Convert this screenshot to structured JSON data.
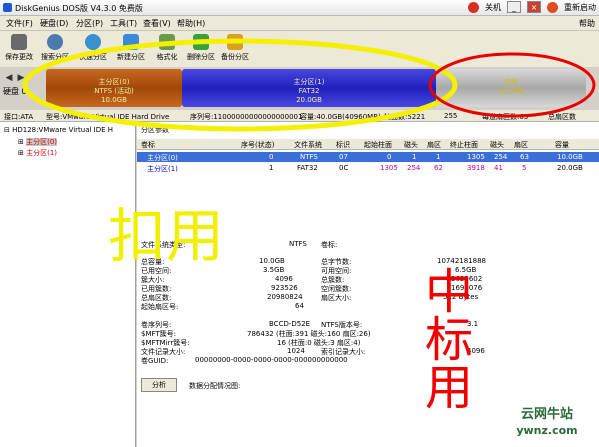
{
  "window": {
    "title": "DiskGenius DOS版 V4.3.0 免费版",
    "power_label": "关机",
    "restart_label": "重新启动"
  },
  "menu": {
    "items": [
      "文件(F)",
      "硬盘(D)",
      "分区(P)",
      "工具(T)",
      "查看(V)",
      "帮助(H)"
    ],
    "help_label": "帮助"
  },
  "toolbar": {
    "buttons": [
      "保存更改",
      "搜索分区",
      "快速分区",
      "新建分区",
      "格式化",
      "删除分区",
      "备份分区"
    ]
  },
  "diskbar": {
    "disk_label": "硬盘 0",
    "partitions": [
      {
        "name": "主分区(0)",
        "fs": "NTFS (活动)",
        "size": "10.0GB"
      },
      {
        "name": "主分区(1)",
        "fs": "FAT32",
        "size": "20.0GB"
      },
      {
        "name": "空闲",
        "fs": "",
        "size": "10.0GB"
      }
    ]
  },
  "infobar": {
    "iface": "接口:ATA",
    "model": "型号:VMware Virtual IDE Hard Drive",
    "serial": "序列号:11000000000000000001",
    "capacity": "容量:40.0GB(40960MB)",
    "cylinders": "柱面数:5221",
    "heads": "255",
    "sectors_per_track": "每道扇区数:63",
    "total_sectors": "总扇区数"
  },
  "tree": {
    "disk": "HD128:VMware Virtual IDE H",
    "parts": [
      "主分区(0)",
      "主分区(1)"
    ]
  },
  "table": {
    "tab": "分区参数",
    "headers": [
      "卷标",
      "序号(状态)",
      "文件系统",
      "标识",
      "起始柱面",
      "磁头",
      "扇区",
      "终止柱面",
      "磁头",
      "扇区",
      "容量"
    ],
    "rows": [
      {
        "label": "主分区(0)",
        "num": "0",
        "fs": "NTFS",
        "id": "07",
        "sc": "0",
        "sh": "1",
        "ss": "1",
        "ec": "1305",
        "eh": "254",
        "es": "63",
        "size": "10.0GB"
      },
      {
        "label": "主分区(1)",
        "num": "1",
        "fs": "FAT32",
        "id": "0C",
        "sc": "1305",
        "sh": "254",
        "ss": "62",
        "ec": "3918",
        "eh": "41",
        "es": "5",
        "size": "20.0GB"
      }
    ]
  },
  "detail": {
    "fs_type_label": "文件系统类型:",
    "fs_type": "NTFS",
    "vol_label": "卷标:",
    "left": [
      [
        "总容量:",
        "10.0GB"
      ],
      [
        "已用空间:",
        "3.5GB"
      ],
      [
        "簇大小:",
        "4096"
      ],
      [
        "已用簇数:",
        "923526"
      ],
      [
        "总扇区数:",
        "20980824"
      ],
      [
        "起始扇区号:",
        "64"
      ]
    ],
    "right": [
      [
        "总字节数:",
        "10742181888"
      ],
      [
        "可用空间:",
        "6.5GB"
      ],
      [
        "总簇数:",
        "2622602"
      ],
      [
        "空闲簇数:",
        "1699076"
      ],
      [
        "扇区大小:",
        "512 Bytes"
      ]
    ],
    "serial": [
      "卷序列号:",
      "BCCD-D52E",
      "NTFS版本号:",
      "3.1"
    ],
    "mft": [
      "$MFT簇号:",
      "786432 (柱面:391 磁头:160 扇区:26)"
    ],
    "mftmirr": [
      "$MFTMirr簇号:",
      "16 (柱面:0 磁头:3 扇区:4)"
    ],
    "rec": [
      "文件记录大小:",
      "1024",
      "索引记录大小:",
      "4096"
    ],
    "guid": [
      "卷GUID:",
      "00000000-0000-0000-0000-000000000000"
    ]
  },
  "bottom": {
    "analyze": "分析",
    "alloc_label": "数据分配情况图:"
  },
  "annotations": {
    "left": "扣用",
    "right": "中标用"
  },
  "watermark": {
    "line1": "云网牛站",
    "line2": "ywnz.com"
  }
}
